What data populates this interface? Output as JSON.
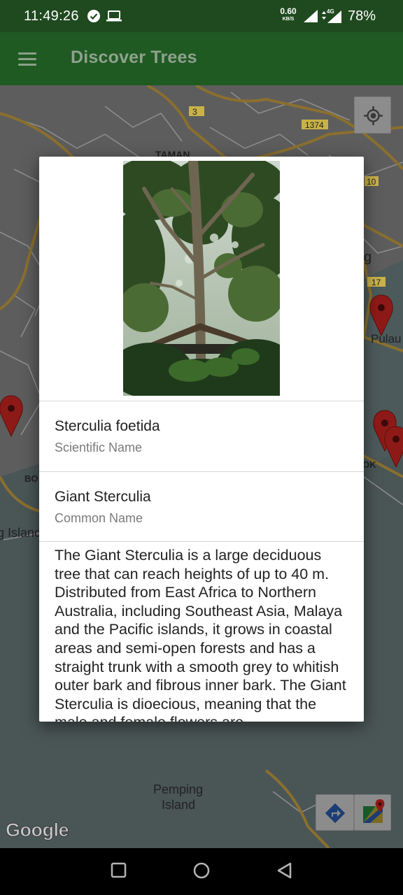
{
  "status_bar": {
    "time": "11:49:26",
    "net_speed_value": "0.60",
    "net_speed_unit": "KB/S",
    "network_type": "4G",
    "battery": "78%"
  },
  "app_bar": {
    "title": "Discover Trees"
  },
  "map": {
    "labels": {
      "road_3": "3",
      "road_1374": "1374",
      "road_10": "10",
      "road_17": "17",
      "taman": "TAMAN",
      "pulau": "Pulau",
      "g_fragment": "g",
      "bo": "BO",
      "ok": "OK",
      "island_left": "g Island",
      "pemping_1": "Pemping",
      "pemping_2": "Island",
      "google": "Google"
    }
  },
  "tree": {
    "scientific_name": "Sterculia foetida",
    "scientific_name_label": "Scientific Name",
    "common_name": "Giant Sterculia",
    "common_name_label": "Common Name",
    "description": "The Giant Sterculia is a large deciduous tree that can reach heights of up to 40 m. Distributed from East Africa to Northern Australia, including Southeast Asia, Malaya and the Pacific islands, it grows in coastal areas and semi-open forests and has a straight trunk with a smooth grey to whitish outer bark and fibrous inner bark. The Giant Sterculia is dioecious, meaning that the male and female flowers are"
  },
  "colors": {
    "app_bar": "#1f5a22",
    "status_bar": "#1f4a1f",
    "marker": "#b3201e"
  }
}
